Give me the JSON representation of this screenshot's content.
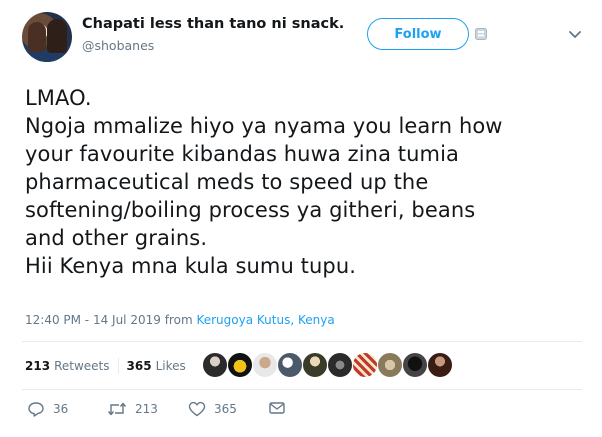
{
  "author": {
    "display_name": "Chapati less than tano ni snack.",
    "handle": "@shobanes"
  },
  "header": {
    "follow_label": "Follow"
  },
  "tweet": {
    "lines": [
      "LMAO.",
      "Ngoja mmalize hiyo ya nyama you learn how",
      "your favourite kibandas huwa zina tumia",
      "pharmaceutical meds to speed up the",
      "softening/boiling process ya githeri, beans",
      "and other grains.",
      "Hii Kenya mna kula sumu tupu."
    ]
  },
  "meta": {
    "timestamp": "12:40 PM - 14 Jul 2019",
    "from_word": "from",
    "location": "Kerugoya Kutus, Kenya"
  },
  "stats": {
    "retweets_count": "213",
    "retweets_label": "Retweets",
    "likes_count": "365",
    "likes_label": "Likes"
  },
  "actions": {
    "reply_count": "36",
    "retweet_count": "213",
    "like_count": "365"
  },
  "colors": {
    "accent": "#1da1f2",
    "secondary_text": "#657786",
    "primary_text": "#14171a",
    "divider": "#e6ecf0"
  },
  "likers": [
    {
      "icon": "avatar-liker-1"
    },
    {
      "icon": "avatar-liker-2"
    },
    {
      "icon": "avatar-liker-3"
    },
    {
      "icon": "avatar-liker-4"
    },
    {
      "icon": "avatar-liker-5"
    },
    {
      "icon": "avatar-liker-6"
    },
    {
      "icon": "avatar-liker-7"
    },
    {
      "icon": "avatar-liker-8"
    },
    {
      "icon": "avatar-liker-9"
    },
    {
      "icon": "avatar-liker-10"
    }
  ]
}
